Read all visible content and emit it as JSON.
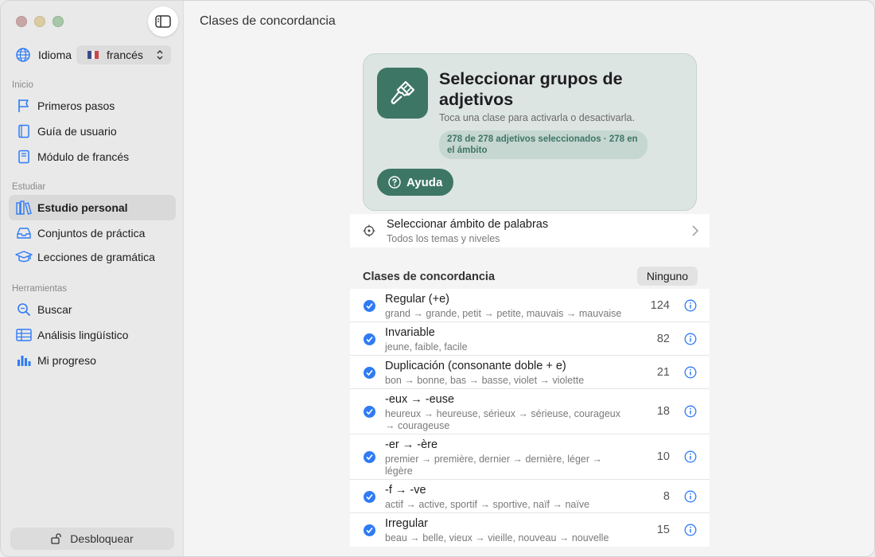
{
  "window": {
    "title": "Clases de concordancia"
  },
  "sidebar": {
    "language_label": "Idioma",
    "language_value": "francés",
    "sections": {
      "inicio": "Inicio",
      "estudiar": "Estudiar",
      "herramientas": "Herramientas"
    },
    "items": [
      {
        "label": "Primeros pasos",
        "icon": "flag-icon"
      },
      {
        "label": "Guía de usuario",
        "icon": "book-icon"
      },
      {
        "label": "Módulo de francés",
        "icon": "book-closed-icon"
      },
      {
        "label": "Estudio personal",
        "icon": "books-shelf-icon",
        "active": true
      },
      {
        "label": "Conjuntos de práctica",
        "icon": "tray-icon"
      },
      {
        "label": "Lecciones de gramática",
        "icon": "graduation-cap-icon"
      },
      {
        "label": "Buscar",
        "icon": "search-icon"
      },
      {
        "label": "Análisis lingüístico",
        "icon": "table-icon"
      },
      {
        "label": "Mi progreso",
        "icon": "bar-chart-icon"
      }
    ],
    "unlock_label": "Desbloquear"
  },
  "hero": {
    "title": "Seleccionar grupos de adjetivos",
    "subtitle": "Toca una clase para activarla o desactivarla.",
    "summary": "278 de 278 adjetivos seleccionados · 278 en el ámbito",
    "help_label": "Ayuda",
    "accent": "#3e7665"
  },
  "scope": {
    "title": "Seleccionar ámbito de palabras",
    "subtitle": "Todos los temas y niveles"
  },
  "list": {
    "header": "Clases de concordancia",
    "none_label": "Ninguno",
    "rows": [
      {
        "title": "Regular (+e)",
        "example": "grand → grande, petit → petite, mauvais → mauvaise",
        "count": "124",
        "checked": true
      },
      {
        "title": "Invariable",
        "example": "jeune, faible, facile",
        "count": "82",
        "checked": true
      },
      {
        "title": "Duplicación (consonante doble + e)",
        "example": "bon → bonne, bas → basse, violet → violette",
        "count": "21",
        "checked": true
      },
      {
        "title": "-eux → -euse",
        "example": "heureux → heureuse, sérieux → sérieuse, courageux → courageuse",
        "count": "18",
        "checked": true
      },
      {
        "title": "-er → -ère",
        "example": "premier → première, dernier → dernière, léger → légère",
        "count": "10",
        "checked": true
      },
      {
        "title": "-f → -ve",
        "example": "actif → active, sportif → sportive, naïf → naïve",
        "count": "8",
        "checked": true
      },
      {
        "title": "Irregular",
        "example": "beau → belle, vieux → vieille, nouveau → nouvelle",
        "count": "15",
        "checked": true
      }
    ]
  },
  "colors": {
    "check_blue": "#2f7bf5",
    "icon_blue": "#2f7bf5"
  }
}
